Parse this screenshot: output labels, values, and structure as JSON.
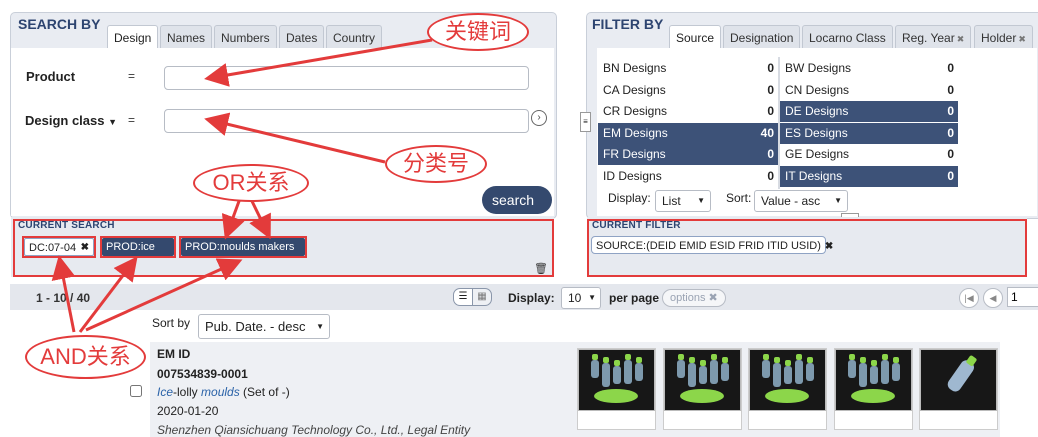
{
  "search_by": {
    "title": "SEARCH BY",
    "tabs": [
      "Design",
      "Names",
      "Numbers",
      "Dates",
      "Country"
    ],
    "product_label": "Product",
    "design_class_label": "Design class",
    "equals": "=",
    "product_value": "",
    "design_class_value": "",
    "search_label": "search",
    "current_search_label": "CURRENT SEARCH",
    "chips": [
      "DC:07-04",
      "PROD:ice",
      "PROD:moulds makers"
    ]
  },
  "filter_by": {
    "title": "FILTER BY",
    "tabs": [
      "Source",
      "Designation",
      "Locarno Class",
      "Reg. Year",
      "Holder"
    ],
    "left_rows": [
      {
        "name": "BN Designs",
        "count": "0",
        "selected": false
      },
      {
        "name": "CA Designs",
        "count": "0",
        "selected": false
      },
      {
        "name": "CR Designs",
        "count": "0",
        "selected": false
      },
      {
        "name": "EM Designs",
        "count": "40",
        "selected": true
      },
      {
        "name": "FR Designs",
        "count": "0",
        "selected": true
      },
      {
        "name": "ID Designs",
        "count": "0",
        "selected": false
      }
    ],
    "right_rows": [
      {
        "name": "BW Designs",
        "count": "0",
        "selected": false
      },
      {
        "name": "CN Designs",
        "count": "0",
        "selected": false
      },
      {
        "name": "DE Designs",
        "count": "0",
        "selected": true
      },
      {
        "name": "ES Designs",
        "count": "0",
        "selected": true
      },
      {
        "name": "GE Designs",
        "count": "0",
        "selected": false
      },
      {
        "name": "IT Designs",
        "count": "0",
        "selected": true
      }
    ],
    "display_label": "Display:",
    "display_value": "List",
    "sort_label": "Sort:",
    "sort_value": "Value - asc",
    "current_filter_label": "CURRENT FILTER",
    "filter_chip": "SOURCE:(DEID EMID ESID FRID ITID USID)"
  },
  "annotations": {
    "keyword": "关键词",
    "class_number": "分类号",
    "or_relation": "OR关系",
    "and_relation": "AND关系"
  },
  "results_bar": {
    "range": "1 - 10 / 40",
    "display_label": "Display:",
    "display_value": "10",
    "per_page": "per page",
    "options": "options",
    "page_value": "1"
  },
  "sort_by": {
    "label": "Sort by",
    "value": "Pub. Date. - desc"
  },
  "result": {
    "id_label": "EM ID",
    "id": "007534839-0001",
    "title_prefix": "Ice",
    "title_mid": "-lolly ",
    "title_highlight": "moulds",
    "title_suffix": " (Set of -)",
    "date": "2020-01-20",
    "holder": "Shenzhen Qiansichuang Technology Co., Ltd., Legal Entity"
  },
  "colors": {
    "accent": "#34496e",
    "annotation": "#e33b3b",
    "thumb_green": "#8cd64a"
  }
}
